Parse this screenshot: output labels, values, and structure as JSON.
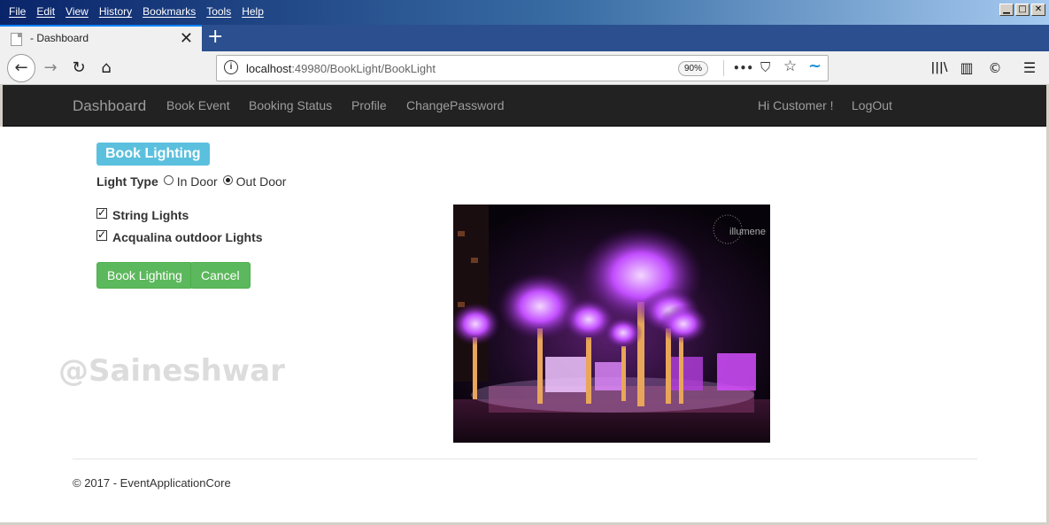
{
  "menu": [
    "File",
    "Edit",
    "View",
    "History",
    "Bookmarks",
    "Tools",
    "Help"
  ],
  "window_controls": {
    "minimize": "▁",
    "maximize": "□",
    "close": "✕"
  },
  "tab": {
    "title": "- Dashboard",
    "close": "✕",
    "new_tab": "+"
  },
  "toolbar": {
    "back": "←",
    "forward": "→",
    "reload": "↻",
    "home": "⌂",
    "info": "i",
    "url_host": "localhost",
    "url_path": ":49980/BookLight/BookLight",
    "zoom": "90%",
    "more": "•••",
    "pocket": "⛉",
    "star": "☆",
    "sync": "~",
    "library": "|||\\",
    "sidebar": "▥",
    "account": "©",
    "menu": "☰"
  },
  "appnav": {
    "brand": "Dashboard",
    "links": [
      "Book Event",
      "Booking Status",
      "Profile",
      "ChangePassword"
    ],
    "greeting": "Hi Customer !",
    "logout": "LogOut"
  },
  "form": {
    "heading": "Book Lighting",
    "light_type_label": "Light Type",
    "options": [
      {
        "label": "In Door",
        "checked": false
      },
      {
        "label": "Out Door",
        "checked": true
      }
    ],
    "checkboxes": [
      {
        "label": "String Lights",
        "checked": true
      },
      {
        "label": "Acqualina outdoor Lights",
        "checked": true
      }
    ],
    "submit": "Book Lighting",
    "cancel": "Cancel"
  },
  "image": {
    "logo_text": "illumene"
  },
  "watermark": "@Saineshwar",
  "footer": "© 2017 - EventApplicationCore",
  "colors": {
    "navbar_bg": "#222222",
    "nav_link": "#9d9d9d",
    "badge_info": "#5bc0de",
    "btn_success": "#5cb85c",
    "photo_purple": "#c04dff"
  }
}
